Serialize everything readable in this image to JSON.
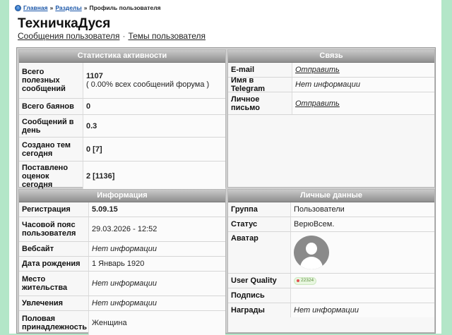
{
  "breadcrumb": {
    "home": "Главная",
    "sections": "Разделы",
    "current": "Профиль пользователя",
    "sep": "»"
  },
  "user": {
    "name": "ТехничкаДуся"
  },
  "sublinks": {
    "messages": "Сообщения пользователя",
    "sep": "·",
    "topics": "Темы пользователя"
  },
  "activity": {
    "title": "Статистика активности",
    "rows": [
      {
        "label": "Всего полезных сообщений",
        "value": "1107",
        "sub": "( 0.00% всех сообщений форума )"
      },
      {
        "label": "Всего баянов",
        "value": "0"
      },
      {
        "label": "Сообщений в день",
        "value": "0.3"
      },
      {
        "label": "Создано тем сегодня",
        "value": "0 [7]"
      },
      {
        "label": "Поставлено оценок сегодня",
        "value": "2 [1136]"
      }
    ]
  },
  "contact": {
    "title": "Связь",
    "rows": [
      {
        "label": "E-mail",
        "value": "Отправить"
      },
      {
        "label": "Имя в Telegram",
        "value": "Нет информации"
      },
      {
        "label": "Личное письмо",
        "value": "Отправить"
      }
    ]
  },
  "info": {
    "title": "Информация",
    "rows": [
      {
        "label": "Регистрация",
        "value": "5.09.15"
      },
      {
        "label": "Часовой пояс пользователя",
        "value": "29.03.2026 - 12:52"
      },
      {
        "label": "Вебсайт",
        "value": "Нет информации"
      },
      {
        "label": "Дата рождения",
        "value": "1 Январь 1920"
      },
      {
        "label": "Место жительства",
        "value": "Нет информации"
      },
      {
        "label": "Увлечения",
        "value": "Нет информации"
      },
      {
        "label": "Половая принадлежность",
        "value": "Женщина"
      }
    ]
  },
  "personal": {
    "title": "Личные данные",
    "rows": [
      {
        "label": "Группа",
        "value": "Пользователи"
      },
      {
        "label": "Статус",
        "value": "ВерюВсем."
      },
      {
        "label": "Аватар",
        "value": ""
      },
      {
        "label": "User Quality",
        "value": "22324"
      },
      {
        "label": "Подпись",
        "value": ""
      },
      {
        "label": "Награды",
        "value": "Нет информации"
      }
    ]
  },
  "colors": {
    "background": "#b3e6c8",
    "header_gradient_top": "#c9c9c9",
    "header_gradient_bottom": "#8f8f8f",
    "link": "#1a56a8"
  }
}
